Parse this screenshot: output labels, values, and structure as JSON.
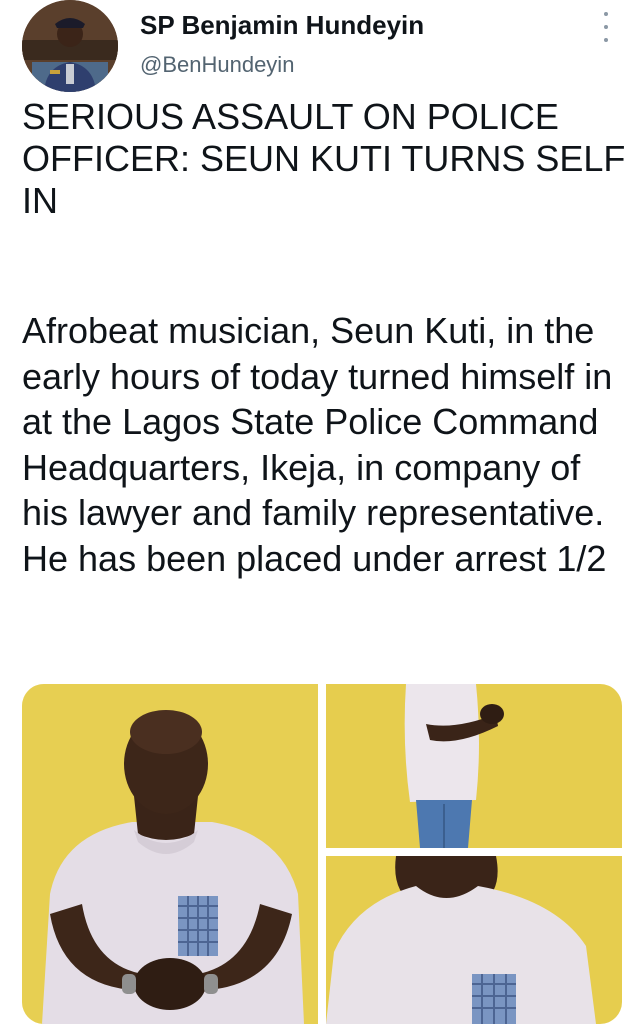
{
  "author": {
    "name": "SP Benjamin Hundeyin",
    "handle": "@BenHundeyin"
  },
  "tweet": {
    "headline": "SERIOUS ASSAULT ON POLICE OFFICER: SEUN KUTI TURNS SELF IN",
    "body": "Afrobeat musician, Seun Kuti, in the early hours of today turned himself in at the Lagos State Police Command Headquarters, Ikeja, in company of his lawyer and family representative. He has been placed under arrest 1/2"
  },
  "icons": {
    "more": "more-vertical-icon"
  },
  "colors": {
    "text": "#0f1419",
    "secondary": "#536471",
    "wall": "#e6cd4e"
  }
}
